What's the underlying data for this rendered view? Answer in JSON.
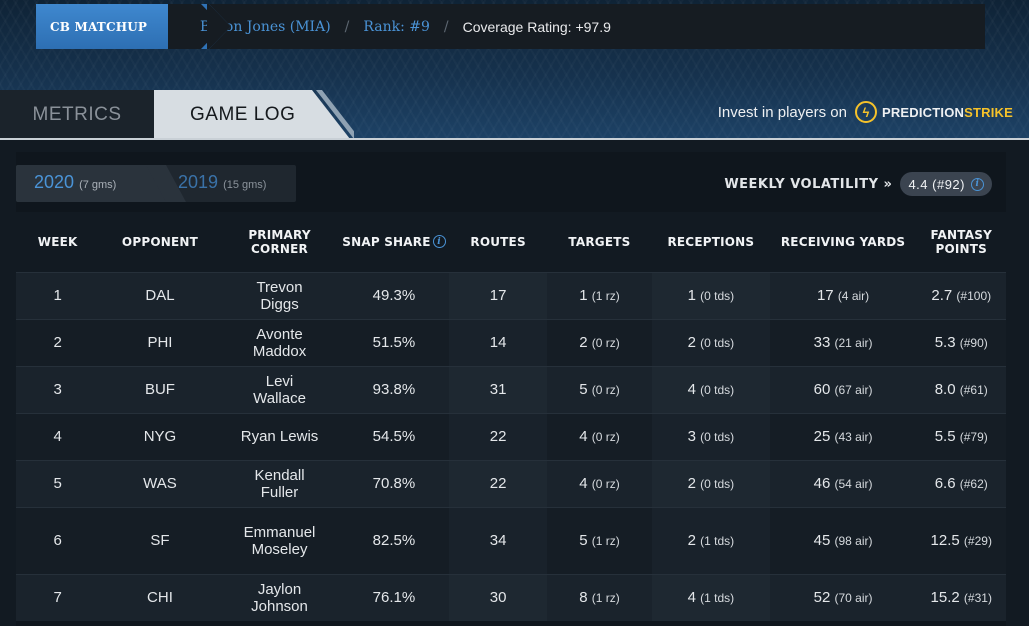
{
  "breadcrumb": {
    "home_label": "CB MATCHUP",
    "player": "Byron Jones (MIA)",
    "rank": "Rank: #9",
    "coverage": "Coverage Rating: +97.9",
    "separator": "/"
  },
  "tabs": [
    {
      "label": "METRICS",
      "active": false
    },
    {
      "label": "GAME LOG",
      "active": true
    }
  ],
  "invest": {
    "text": "Invest in players on",
    "brand_part1": "PREDICTION",
    "brand_part2": "STRIKE"
  },
  "seasons": [
    {
      "year": "2020",
      "games": "(7 gms)",
      "active": true
    },
    {
      "year": "2019",
      "games": "(15 gms)",
      "active": false
    }
  ],
  "volatility": {
    "label": "WEEKLY VOLATILITY »",
    "value": "4.4 (#92)"
  },
  "colors": {
    "accent_blue": "#4a93d6",
    "brand_yellow": "#f6c22a",
    "header_blue": "#2f72b6"
  },
  "table": {
    "headers": [
      "WEEK",
      "OPPONENT",
      "PRIMARY CORNER",
      "SNAP SHARE",
      "ROUTES",
      "TARGETS",
      "RECEPTIONS",
      "RECEIVING YARDS",
      "FANTASY POINTS"
    ],
    "rows": [
      {
        "week": "1",
        "opp": "DAL",
        "corner": "Trevon Diggs",
        "snap": "49.3%",
        "routes": "17",
        "targets": "1",
        "targets_sub": "(1 rz)",
        "rec": "1",
        "rec_sub": "(0 tds)",
        "yards": "17",
        "yards_sub": "(4 air)",
        "pts": "2.7",
        "pts_sub": "(#100)"
      },
      {
        "week": "2",
        "opp": "PHI",
        "corner": "Avonte Maddox",
        "snap": "51.5%",
        "routes": "14",
        "targets": "2",
        "targets_sub": "(0 rz)",
        "rec": "2",
        "rec_sub": "(0 tds)",
        "yards": "33",
        "yards_sub": "(21 air)",
        "pts": "5.3",
        "pts_sub": "(#90)"
      },
      {
        "week": "3",
        "opp": "BUF",
        "corner": "Levi Wallace",
        "snap": "93.8%",
        "routes": "31",
        "targets": "5",
        "targets_sub": "(0 rz)",
        "rec": "4",
        "rec_sub": "(0 tds)",
        "yards": "60",
        "yards_sub": "(67 air)",
        "pts": "8.0",
        "pts_sub": "(#61)"
      },
      {
        "week": "4",
        "opp": "NYG",
        "corner": "Ryan Lewis",
        "snap": "54.5%",
        "routes": "22",
        "targets": "4",
        "targets_sub": "(0 rz)",
        "rec": "3",
        "rec_sub": "(0 tds)",
        "yards": "25",
        "yards_sub": "(43 air)",
        "pts": "5.5",
        "pts_sub": "(#79)"
      },
      {
        "week": "5",
        "opp": "WAS",
        "corner": "Kendall Fuller",
        "snap": "70.8%",
        "routes": "22",
        "targets": "4",
        "targets_sub": "(0 rz)",
        "rec": "2",
        "rec_sub": "(0 tds)",
        "yards": "46",
        "yards_sub": "(54 air)",
        "pts": "6.6",
        "pts_sub": "(#62)"
      },
      {
        "week": "6",
        "opp": "SF",
        "corner": "Emmanuel Moseley",
        "snap": "82.5%",
        "routes": "34",
        "targets": "5",
        "targets_sub": "(1 rz)",
        "rec": "2",
        "rec_sub": "(1 tds)",
        "yards": "45",
        "yards_sub": "(98 air)",
        "pts": "12.5",
        "pts_sub": "(#29)"
      },
      {
        "week": "7",
        "opp": "CHI",
        "corner": "Jaylon Johnson",
        "snap": "76.1%",
        "routes": "30",
        "targets": "8",
        "targets_sub": "(1 rz)",
        "rec": "4",
        "rec_sub": "(1 tds)",
        "yards": "52",
        "yards_sub": "(70 air)",
        "pts": "15.2",
        "pts_sub": "(#31)"
      }
    ]
  }
}
